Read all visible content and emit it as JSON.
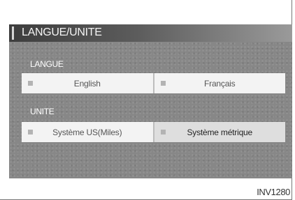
{
  "screen": {
    "title": "LANGUE/UNITE"
  },
  "langue": {
    "label": "LANGUE",
    "options": [
      "English",
      "Français"
    ]
  },
  "unite": {
    "label": "UNITE",
    "options": [
      "Système US(Miles)",
      "Système métrique"
    ]
  },
  "figure_code": "INV1280",
  "colors": {
    "background_screen": "#878787",
    "option_unselected": "#f3f3f3",
    "option_selected": "#dedede",
    "title_bar_dark": "#3d3d3d"
  }
}
